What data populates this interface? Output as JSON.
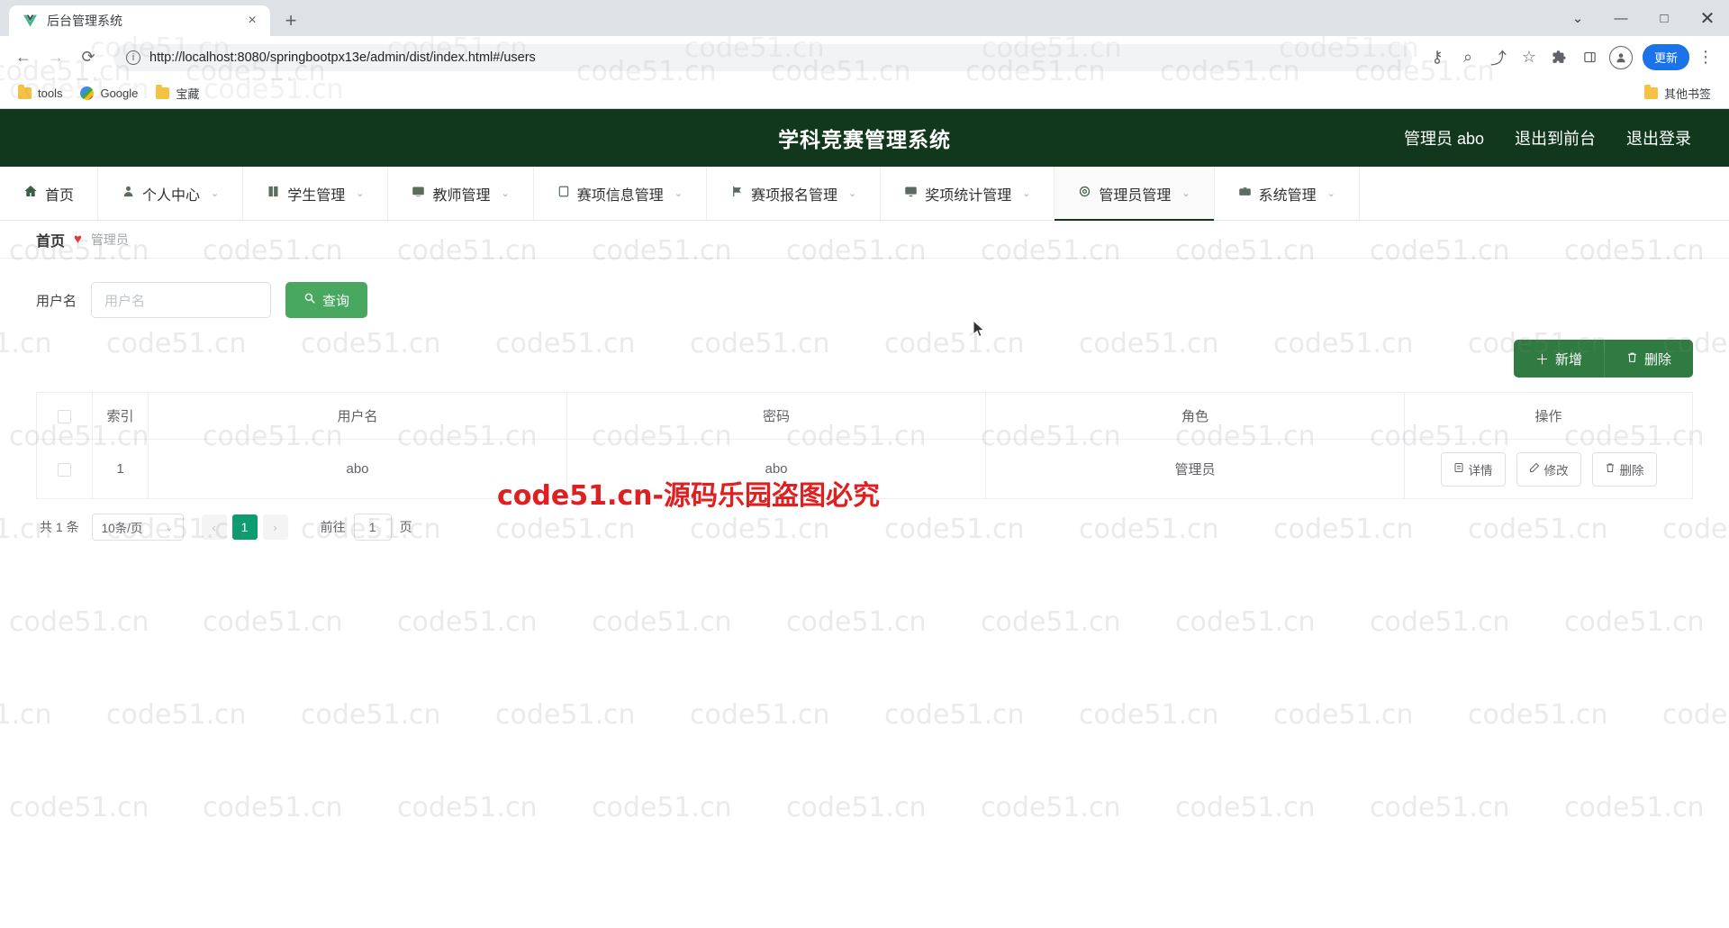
{
  "browser": {
    "tab": {
      "title": "后台管理系统",
      "favicon": "vue-logo-icon",
      "close": "×"
    },
    "new_tab": "+",
    "window_controls": {
      "minimize": "—",
      "maximize": "□",
      "close": "✕",
      "menu_caret": "⌄"
    },
    "toolbar": {
      "back": "←",
      "forward": "→",
      "reload": "⟳",
      "url": "http://localhost:8080/springbootpx13e/admin/dist/index.html#/users",
      "info_icon": "ⓘ",
      "key_icon": "⚷",
      "zoom_icon": "⌕",
      "share_icon": "⤴",
      "star_icon": "☆",
      "extensions_icon": "🧩",
      "sidepanel_icon": "▣",
      "profile_icon": "person-icon",
      "update_label": "更新",
      "menu_icon": "⋮"
    },
    "bookmarks": [
      {
        "label": "tools",
        "icon": "folder-icon"
      },
      {
        "label": "Google",
        "icon": "globe-icon"
      },
      {
        "label": "宝藏",
        "icon": "folder-icon"
      }
    ],
    "bookmarks_right": {
      "label": "其他书签",
      "icon": "folder-icon"
    }
  },
  "app": {
    "title": "学科竞赛管理系统",
    "header_links": [
      {
        "label": "管理员 abo"
      },
      {
        "label": "退出到前台"
      },
      {
        "label": "退出登录"
      }
    ],
    "nav": [
      {
        "label": "首页",
        "icon": "home-icon",
        "caret": false,
        "active": false
      },
      {
        "label": "个人中心",
        "icon": "user-icon",
        "caret": true,
        "active": false
      },
      {
        "label": "学生管理",
        "icon": "book-icon",
        "caret": true,
        "active": false
      },
      {
        "label": "教师管理",
        "icon": "board-icon",
        "caret": true,
        "active": false
      },
      {
        "label": "赛项信息管理",
        "icon": "doc-icon",
        "caret": true,
        "active": false
      },
      {
        "label": "赛项报名管理",
        "icon": "flag-icon",
        "caret": true,
        "active": false
      },
      {
        "label": "奖项统计管理",
        "icon": "monitor-icon",
        "caret": true,
        "active": false
      },
      {
        "label": "管理员管理",
        "icon": "gear-icon",
        "caret": true,
        "active": true
      },
      {
        "label": "系统管理",
        "icon": "case-icon",
        "caret": true,
        "active": false
      }
    ],
    "breadcrumb": {
      "home": "首页",
      "heart": "♥",
      "current": "管理员"
    },
    "search": {
      "label": "用户名",
      "placeholder": "用户名",
      "value": "",
      "button_label": "查询",
      "button_icon": "search-icon"
    },
    "actions": [
      {
        "label": "新增",
        "icon": "plus-icon"
      },
      {
        "label": "删除",
        "icon": "trash-icon"
      }
    ],
    "table": {
      "columns": [
        "",
        "索引",
        "用户名",
        "密码",
        "角色",
        "操作"
      ],
      "rows": [
        {
          "index": "1",
          "username": "abo",
          "password": "abo",
          "role": "管理员",
          "ops": [
            {
              "label": "详情",
              "icon": "detail-icon"
            },
            {
              "label": "修改",
              "icon": "edit-icon"
            },
            {
              "label": "删除",
              "icon": "trash-icon"
            }
          ]
        }
      ]
    },
    "pagination": {
      "total": "共 1 条",
      "page_size": "10条/页",
      "prev": "‹",
      "next": "›",
      "current_page": "1",
      "goto_label": "前往",
      "goto_value": "1",
      "goto_suffix": "页"
    }
  },
  "watermark": {
    "text": "code51.cn",
    "red_text": "code51.cn-源码乐园盗图必究",
    "red_color": "#e02020"
  },
  "colors": {
    "header_green": "#11381c",
    "button_green": "#48a860",
    "action_green": "#2f7b41",
    "pager_teal": "#0d9c6f",
    "accent_blue": "#1a73e8"
  }
}
